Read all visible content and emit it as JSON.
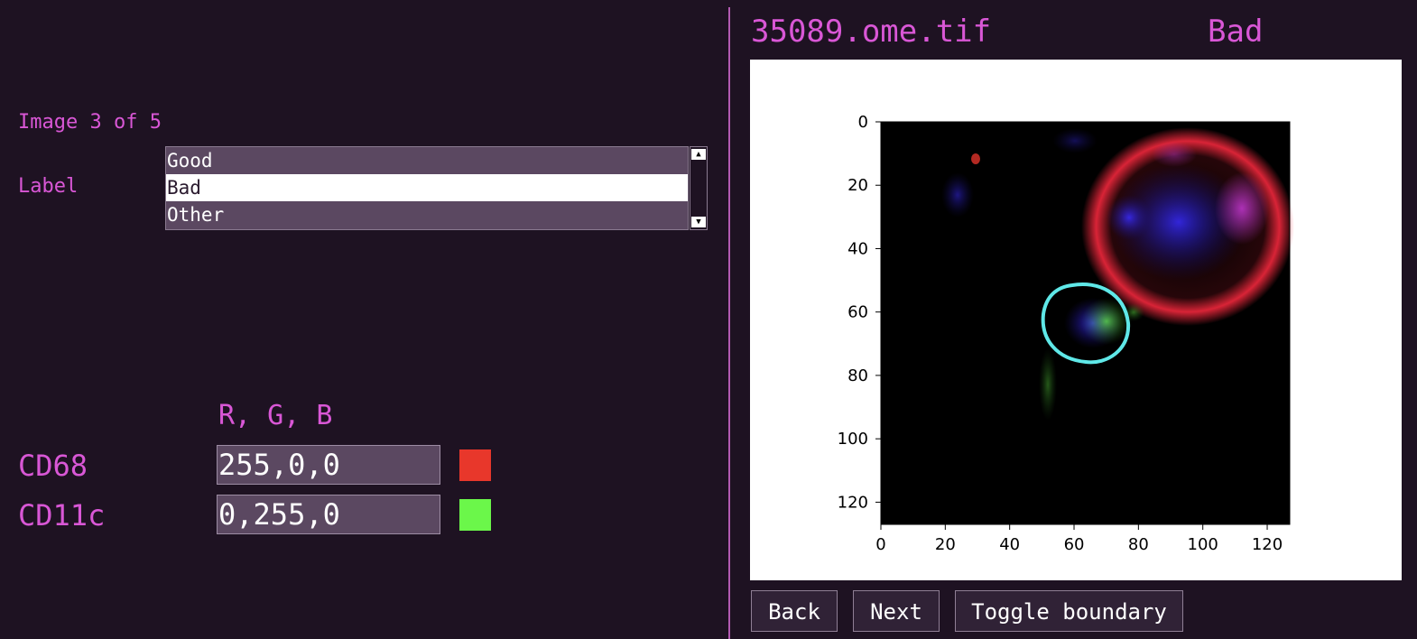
{
  "left_panel": {
    "image_counter": "Image 3 of 5",
    "label_caption": "Label",
    "label_options": [
      "Good",
      "Bad",
      "Other"
    ],
    "selected_label": "Bad",
    "rgb_header": "R, G, B",
    "markers": [
      {
        "name": "CD68",
        "rgb": "255,0,0",
        "color": "#e8372b"
      },
      {
        "name": "CD11c",
        "rgb": "0,255,0",
        "color": "#6bf74a"
      }
    ]
  },
  "right_panel": {
    "file_name": "35089.ome.tif",
    "label_status": "Bad"
  },
  "plot": {
    "x_ticks": [
      "0",
      "20",
      "40",
      "60",
      "80",
      "100",
      "120"
    ],
    "y_ticks": [
      "0",
      "20",
      "40",
      "60",
      "80",
      "100",
      "120"
    ],
    "x_range": [
      0,
      127
    ],
    "y_range": [
      0,
      127
    ],
    "boundary_color": "#5fe8e8"
  },
  "buttons": {
    "back": "Back",
    "next": "Next",
    "toggle_boundary": "Toggle boundary"
  },
  "colors": {
    "background": "#1e1222",
    "accent": "#d957d6",
    "field_bg": "#5b4861"
  }
}
